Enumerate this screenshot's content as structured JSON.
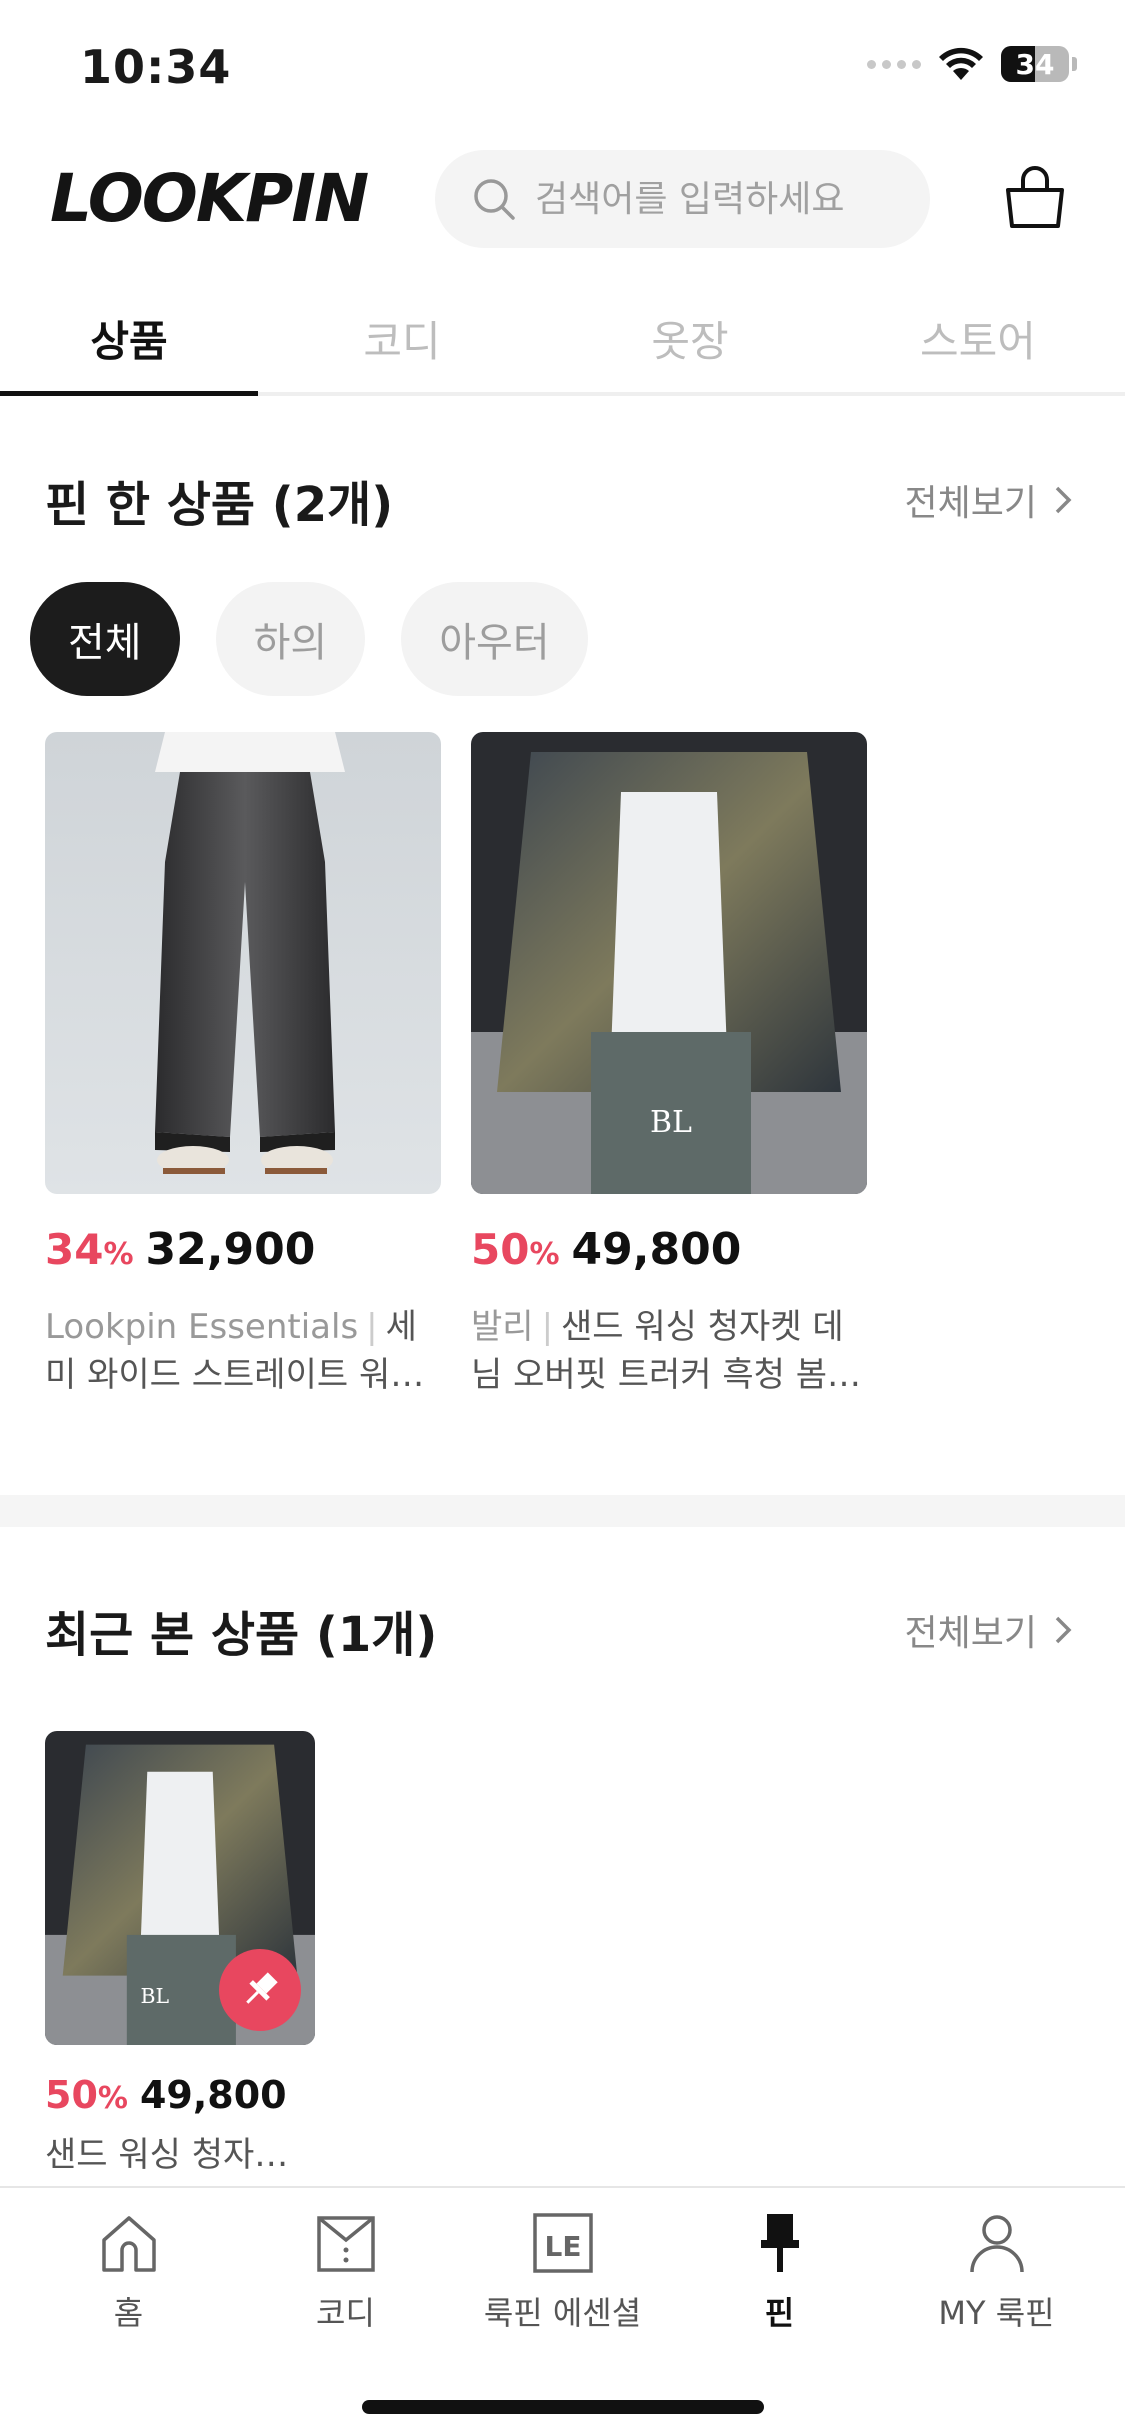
{
  "status_bar": {
    "time": "10:34",
    "battery": "34"
  },
  "header": {
    "logo": "LOOKPIN",
    "search_placeholder": "검색어를 입력하세요"
  },
  "tabs": [
    {
      "label": "상품",
      "active": true
    },
    {
      "label": "코디",
      "active": false
    },
    {
      "label": "옷장",
      "active": false
    },
    {
      "label": "스토어",
      "active": false
    }
  ],
  "pinned": {
    "title": "핀 한 상품 (2개)",
    "view_all": "전체보기",
    "chips": [
      "전체",
      "하의",
      "아우터"
    ],
    "products": [
      {
        "discount": "34",
        "percent": "%",
        "price": "32,900",
        "brand": "Lookpin Essentials",
        "name": "세미 와이드 스트레이트 워싱 데님 팬츠"
      },
      {
        "discount": "50",
        "percent": "%",
        "price": "49,800",
        "brand": "발리",
        "name": "샌드 워싱 청자켓 데님 오버핏 트러커 흑청 봄 가을 자켓"
      }
    ]
  },
  "recent": {
    "title": "최근 본 상품 (1개)",
    "view_all": "전체보기",
    "products": [
      {
        "discount": "50",
        "percent": "%",
        "price": "49,800",
        "name": "샌드 워싱 청자켓 데님"
      }
    ]
  },
  "nav": [
    {
      "label": "홈",
      "icon": "home-icon"
    },
    {
      "label": "코디",
      "icon": "codi-icon"
    },
    {
      "label": "룩핀 에센셜",
      "icon": "le-icon"
    },
    {
      "label": "핀",
      "icon": "pin-icon",
      "active": true
    },
    {
      "label": "MY 룩핀",
      "icon": "user-icon"
    }
  ],
  "colors": {
    "accent": "#e8475f",
    "text": "#111111",
    "muted": "#999999"
  }
}
